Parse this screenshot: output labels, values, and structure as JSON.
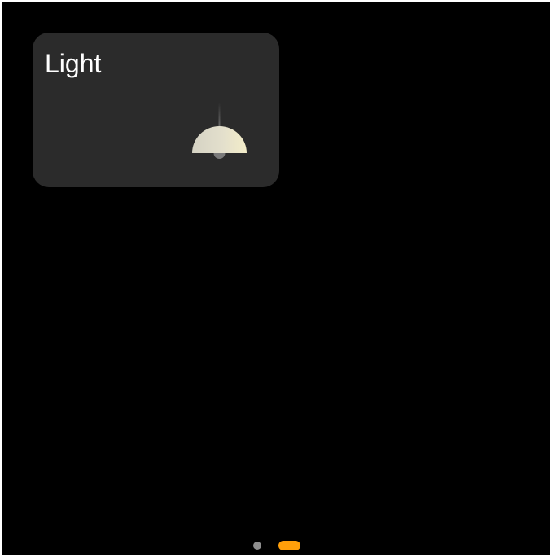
{
  "card": {
    "title": "Light",
    "icon": "pendant-lamp-icon",
    "background_color": "#2b2b2b"
  },
  "pager": {
    "pages": 2,
    "current_page": 2,
    "inactive_color": "#8e8e8e",
    "active_color": "#ff9f0a"
  },
  "colors": {
    "screen_background": "#000000",
    "text": "#ffffff"
  }
}
